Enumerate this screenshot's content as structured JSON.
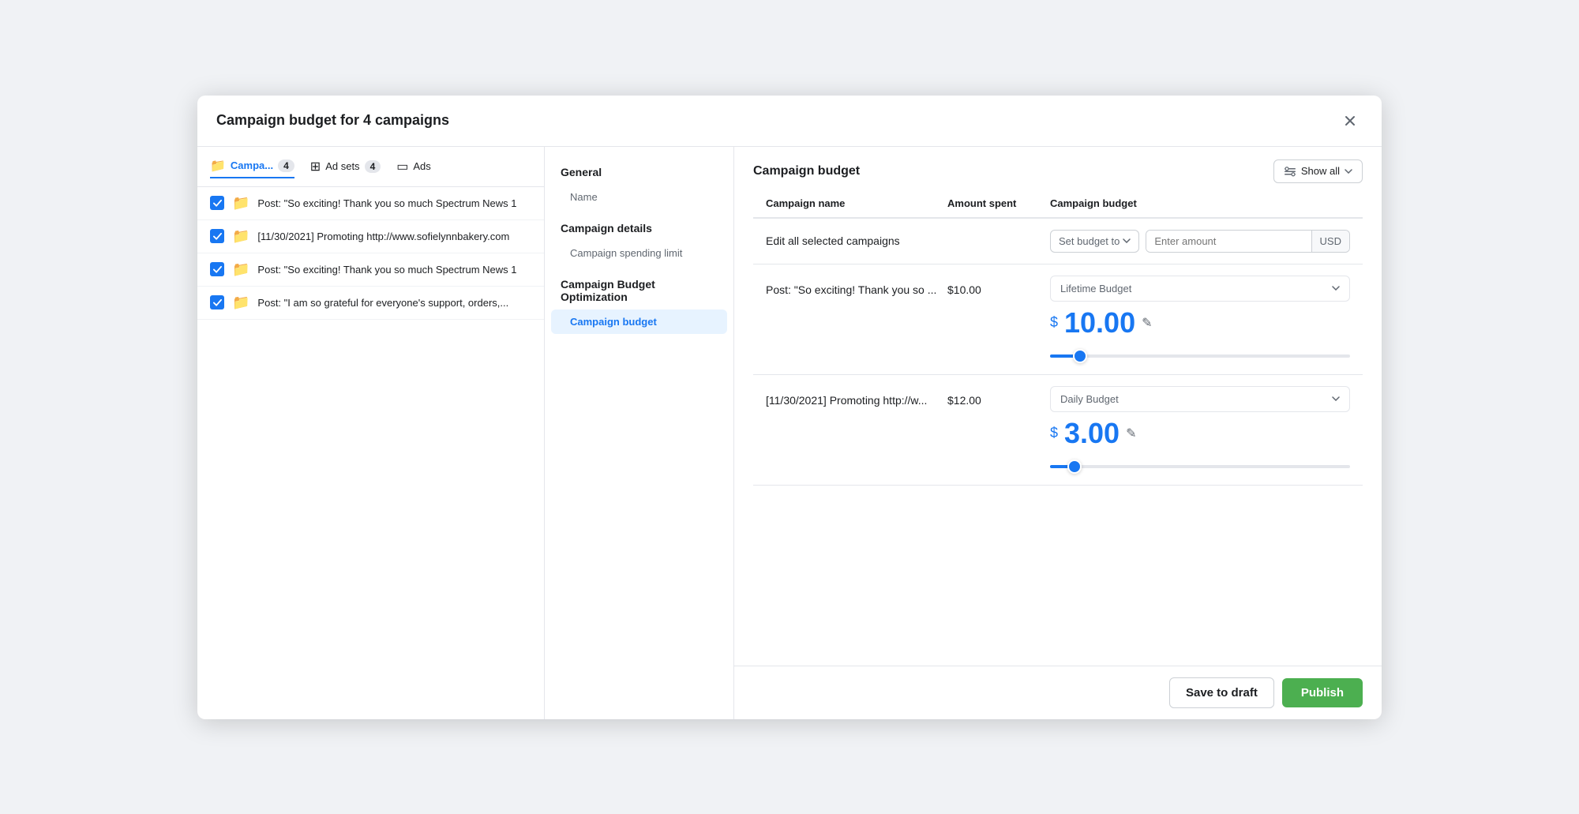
{
  "modal": {
    "title": "Campaign budget for 4 campaigns",
    "close_label": "×"
  },
  "tabs": [
    {
      "id": "campaigns",
      "icon": "📁",
      "label": "Campa...",
      "badge": "4",
      "active": true
    },
    {
      "id": "adsets",
      "icon": "⊞",
      "label": "Ad sets",
      "badge": "4",
      "active": false
    },
    {
      "id": "ads",
      "icon": "▭",
      "label": "Ads",
      "badge": "",
      "active": false
    }
  ],
  "campaign_items": [
    {
      "id": 1,
      "name": "Post: \"So exciting! Thank you so much Spectrum News 1"
    },
    {
      "id": 2,
      "name": "[11/30/2021] Promoting http://www.sofielynnbakery.com"
    },
    {
      "id": 3,
      "name": "Post: \"So exciting! Thank you so much Spectrum News 1"
    },
    {
      "id": 4,
      "name": "Post: \"I am so grateful for everyone's support, orders,..."
    }
  ],
  "nav": {
    "sections": [
      {
        "title": "General",
        "items": [
          "Name"
        ]
      },
      {
        "title": "Campaign details",
        "items": [
          "Campaign spending limit"
        ]
      },
      {
        "title": "Campaign Budget Optimization",
        "items": [
          "Campaign budget"
        ]
      }
    ],
    "active_item": "Campaign budget"
  },
  "content": {
    "title": "Campaign budget",
    "show_all_label": "Show all",
    "table": {
      "headers": [
        "Campaign name",
        "Amount spent",
        "Campaign budget"
      ],
      "edit_all_label": "Edit all selected campaigns",
      "set_budget_label": "Set budget to",
      "amount_placeholder": "Enter amount",
      "currency": "USD",
      "rows": [
        {
          "name": "Post: \"So exciting! Thank you so ...",
          "amount_spent": "$10.00",
          "budget_type": "Lifetime Budget",
          "budget_value": "10.00",
          "slider_value": "8"
        },
        {
          "name": "[11/30/2021] Promoting http://w...",
          "amount_spent": "$12.00",
          "budget_type": "Daily Budget",
          "budget_value": "3.00",
          "slider_value": "6"
        }
      ]
    }
  },
  "footer": {
    "save_draft_label": "Save to draft",
    "publish_label": "Publish"
  }
}
